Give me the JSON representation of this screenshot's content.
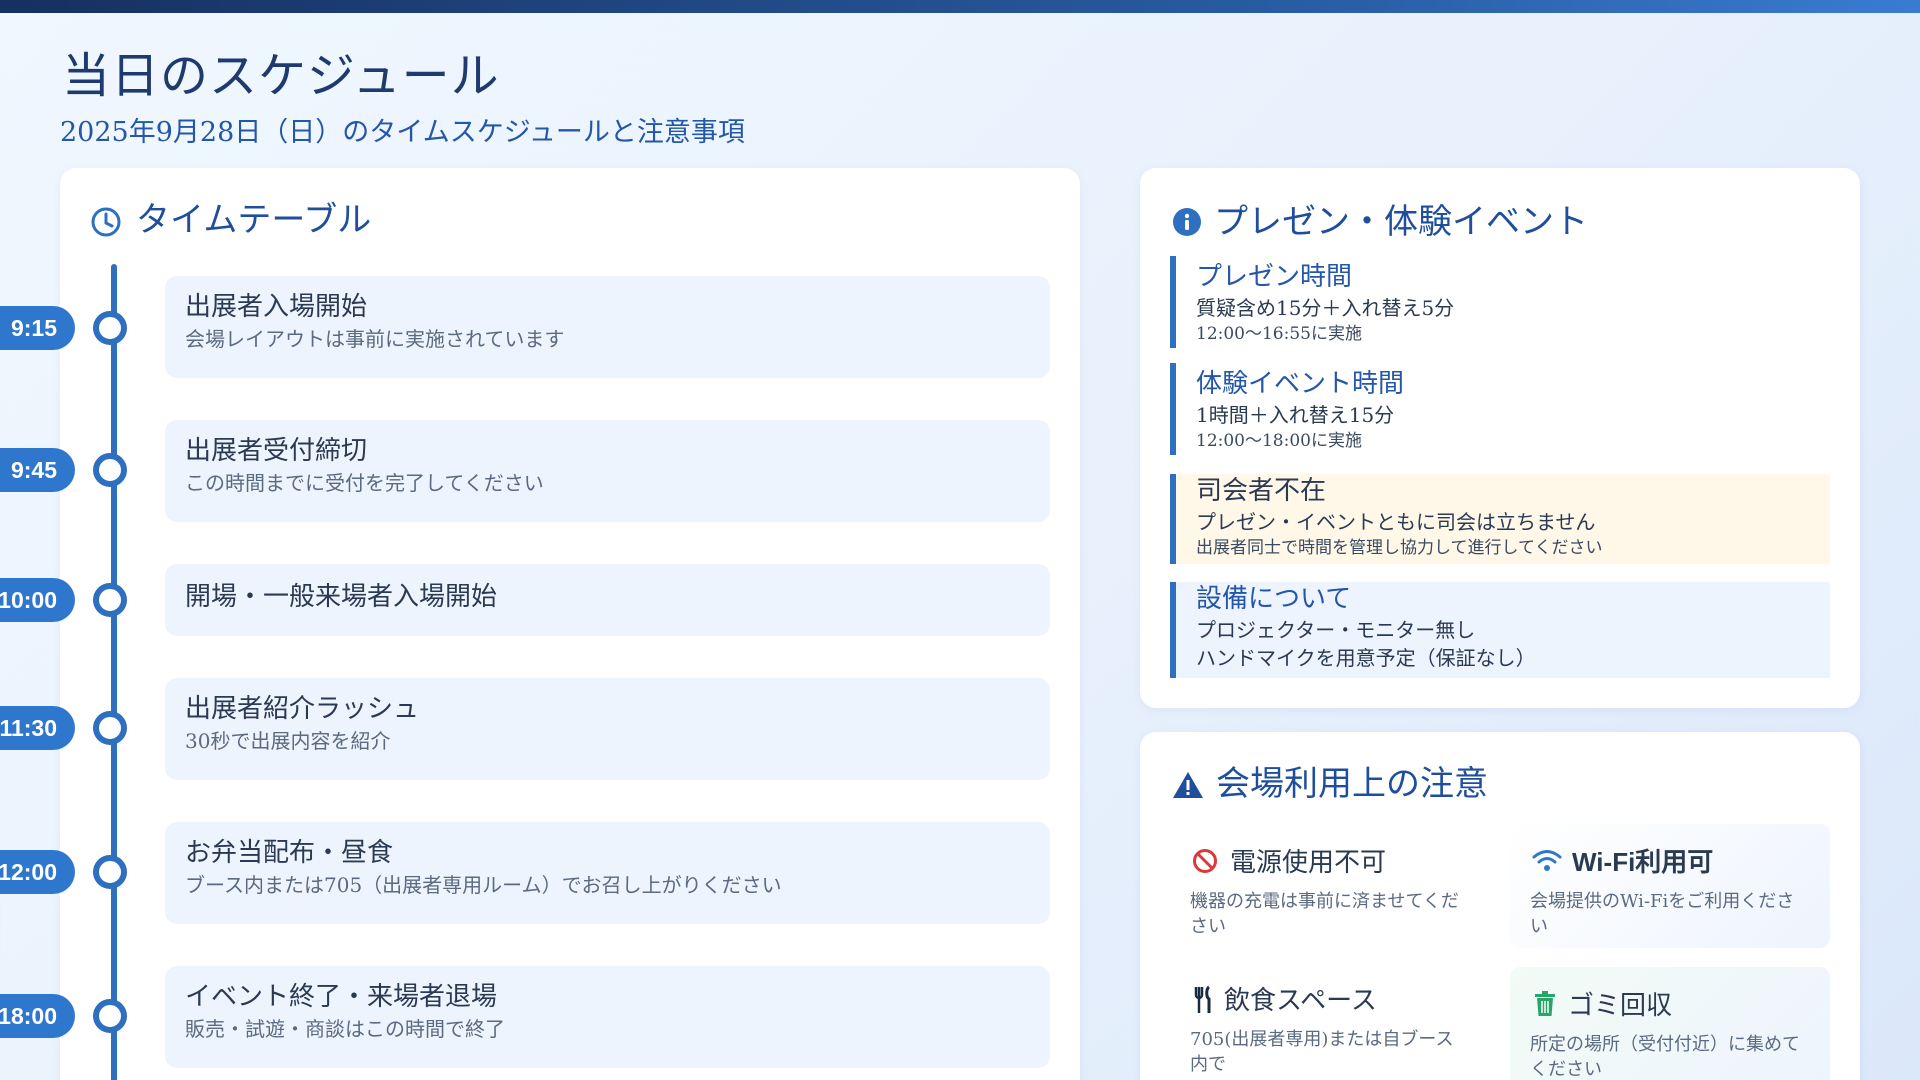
{
  "page": {
    "title": "当日のスケジュール",
    "subtitle": "2025年9月28日（日）のタイムスケジュールと注意事項"
  },
  "timetable": {
    "heading": "タイムテーブル",
    "icon": "clock-icon",
    "items": [
      {
        "time": "9:15",
        "title": "出展者入場開始",
        "desc": "会場レイアウトは事前に実施されています"
      },
      {
        "time": "9:45",
        "title": "出展者受付締切",
        "desc": "この時間までに受付を完了してください"
      },
      {
        "time": "10:00",
        "title": "開場・一般来場者入場開始",
        "desc": ""
      },
      {
        "time": "11:30",
        "title": "出展者紹介ラッシュ",
        "desc": "30秒で出展内容を紹介"
      },
      {
        "time": "12:00",
        "title": "お弁当配布・昼食",
        "desc": "ブース内または705（出展者専用ルーム）でお召し上がりください"
      },
      {
        "time": "18:00",
        "title": "イベント終了・来場者退場",
        "desc": "販売・試遊・商談はこの時間で終了"
      }
    ]
  },
  "events": {
    "heading": "プレゼン・体験イベント",
    "icon": "info-icon",
    "blocks": [
      {
        "title": "プレゼン時間",
        "line1": "質疑含め15分＋入れ替え5分",
        "line2": "12:00～16:55に実施"
      },
      {
        "title": "体験イベント時間",
        "line1": "1時間＋入れ替え15分",
        "line2": "12:00～18:00に実施"
      },
      {
        "title": "司会者不在",
        "line1": "プレゼン・イベントともに司会は立ちません",
        "line2": "出展者同士で時間を管理し協力して進行してください"
      },
      {
        "title": "設備について",
        "line1": "プロジェクター・モニター無し",
        "line2": "ハンドマイクを用意予定（保証なし）"
      }
    ]
  },
  "rules": {
    "heading": "会場利用上の注意",
    "icon": "warning-icon",
    "items": [
      {
        "title": "電源使用不可",
        "desc": "機器の充電は事前に済ませてください",
        "icon": "no-power-icon"
      },
      {
        "title": "Wi-Fi利用可",
        "desc": "会場提供のWi-Fiをご利用ください",
        "icon": "wifi-icon"
      },
      {
        "title": "飲食スペース",
        "desc": "705(出展者専用)または自ブース内で",
        "icon": "utensils-icon"
      },
      {
        "title": "ゴミ回収",
        "desc": "所定の場所（受付付近）に集めてください",
        "icon": "trash-icon"
      }
    ]
  },
  "colors": {
    "accent": "#2f6fc0",
    "heading": "#1f4f9c",
    "warn_bg": "#fff8e8",
    "danger": "#d93a3a",
    "success": "#2aa56a"
  }
}
